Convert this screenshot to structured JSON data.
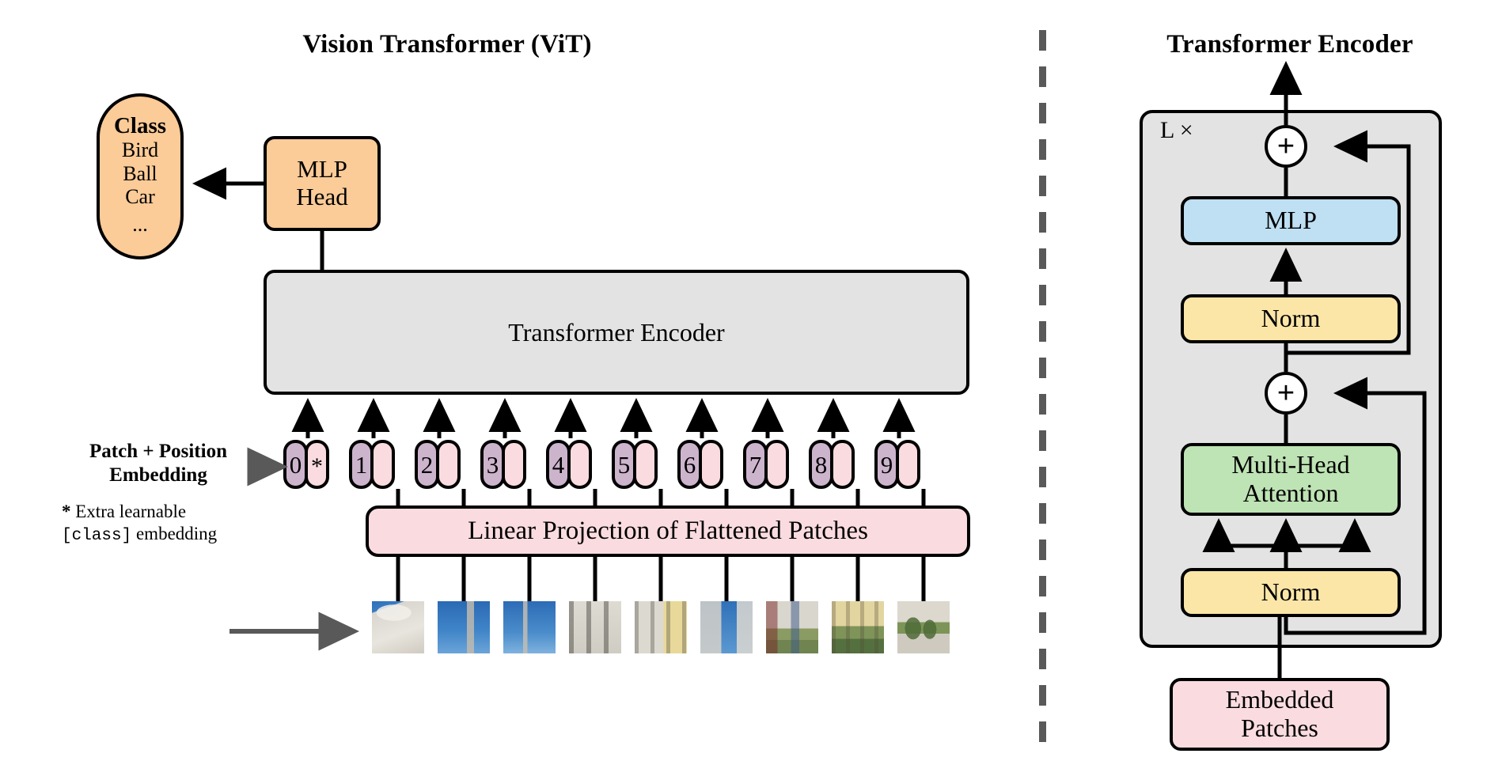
{
  "titles": {
    "left": "Vision Transformer (ViT)",
    "right": "Transformer Encoder"
  },
  "left_panel": {
    "class_box": {
      "heading": "Class",
      "items": [
        "Bird",
        "Ball",
        "Car"
      ],
      "ellipsis": "...",
      "color": "#FBCB98"
    },
    "mlp_head": {
      "line1": "MLP",
      "line2": "Head",
      "color": "#FBCB98"
    },
    "encoder": {
      "label": "Transformer Encoder",
      "color": "#E3E3E3"
    },
    "linear_projection": {
      "label": "Linear Projection of Flattened Patches",
      "color": "#FADCE0"
    },
    "patch_position_label": {
      "line1": "Patch + Position",
      "line2": "Embedding"
    },
    "footnote": {
      "marker": "*",
      "line1": " Extra learnable",
      "mono": "[class]",
      "line2": " embedding"
    },
    "tokens": [
      {
        "pos": "0",
        "patch": "*"
      },
      {
        "pos": "1",
        "patch": ""
      },
      {
        "pos": "2",
        "patch": ""
      },
      {
        "pos": "3",
        "patch": ""
      },
      {
        "pos": "4",
        "patch": ""
      },
      {
        "pos": "5",
        "patch": ""
      },
      {
        "pos": "6",
        "patch": ""
      },
      {
        "pos": "7",
        "patch": ""
      },
      {
        "pos": "8",
        "patch": ""
      },
      {
        "pos": "9",
        "patch": ""
      }
    ],
    "token_colors": {
      "position": "#CDB4CD",
      "patch": "#FADCE0"
    }
  },
  "right_panel": {
    "repeat_label": "L ×",
    "outer_color": "#E3E3E3",
    "blocks": [
      {
        "id": "mlp",
        "label": "MLP",
        "color": "#BFDFF2"
      },
      {
        "id": "norm-top",
        "label": "Norm",
        "color": "#FBE6A8"
      },
      {
        "id": "mha",
        "label_line1": "Multi-Head",
        "label_line2": "Attention",
        "color": "#BEE3B4"
      },
      {
        "id": "norm-bottom",
        "label": "Norm",
        "color": "#FBE6A8"
      },
      {
        "id": "embedded-patches",
        "label_line1": "Embedded",
        "label_line2": "Patches",
        "color": "#FADCE0"
      }
    ],
    "adders": [
      {
        "symbol": "+"
      },
      {
        "symbol": "+"
      }
    ]
  },
  "divider": {
    "color": "#595959",
    "style": "dashed-vertical"
  },
  "arrow_color": "#000000",
  "gray_arrow_color": "#595959"
}
